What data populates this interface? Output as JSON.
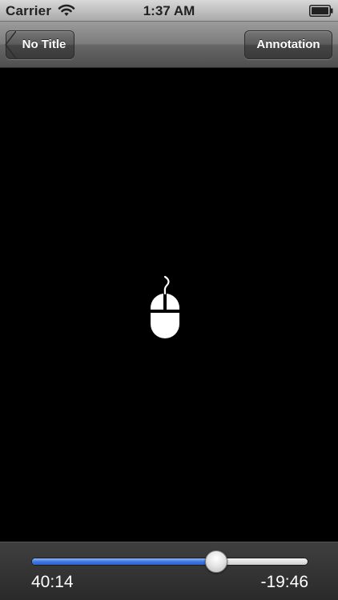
{
  "status_bar": {
    "carrier": "Carrier",
    "time": "1:37 AM",
    "icons": [
      "wifi-icon",
      "battery-icon"
    ]
  },
  "nav_bar": {
    "back_label": "No Title",
    "action_label": "Annotation"
  },
  "video": {
    "placeholder_icon": "mouse-icon"
  },
  "playback": {
    "elapsed": "40:14",
    "remaining": "-19:46",
    "progress_fraction": 0.67,
    "accent_color": "#3a75e0"
  }
}
